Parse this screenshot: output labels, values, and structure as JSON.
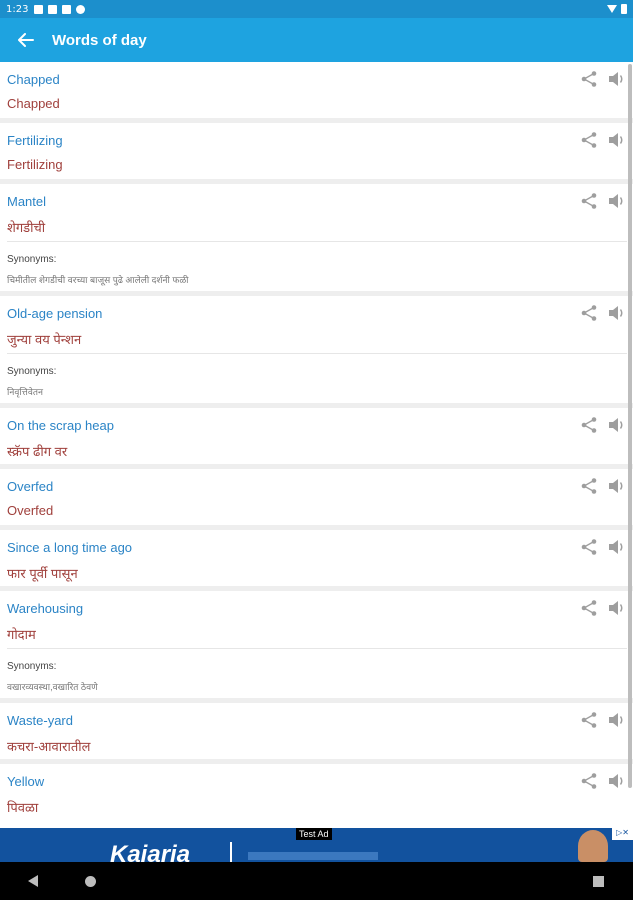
{
  "status_bar": {
    "time": "1:23"
  },
  "app_bar": {
    "title": "Words of day"
  },
  "words": [
    {
      "word": "Chapped",
      "meaning": "Chapped"
    },
    {
      "word": "Fertilizing",
      "meaning": "Fertilizing"
    },
    {
      "word": "Mantel",
      "meaning": "शेगडीची",
      "synonyms_label": "Synonyms:",
      "synonyms": "चिमीतील शेगडीची वरच्या बाजूस पुढे आलेली दर्शनी फळी"
    },
    {
      "word": "Old-age pension",
      "meaning": "जुन्या वय पेन्शन",
      "synonyms_label": "Synonyms:",
      "synonyms": "निवृत्तिवेतन"
    },
    {
      "word": "On the scrap heap",
      "meaning": "स्क्रॅप ढीग वर"
    },
    {
      "word": "Overfed",
      "meaning": "Overfed"
    },
    {
      "word": "Since a long time ago",
      "meaning": "फार पूर्वी पासून"
    },
    {
      "word": "Warehousing",
      "meaning": "गोदाम",
      "synonyms_label": "Synonyms:",
      "synonyms": "वखारव्यवस्था,वखारित ठेवणे"
    },
    {
      "word": "Waste-yard",
      "meaning": "कचरा-आवारातील"
    },
    {
      "word": "Yellow",
      "meaning": "पिवळा"
    }
  ],
  "ad": {
    "label": "Test Ad",
    "brand": "Kajaria"
  },
  "icons": {
    "back": "arrow-left-icon",
    "share": "share-icon",
    "speaker": "speaker-icon"
  },
  "colors": {
    "app_bar": "#1ea3e0",
    "status_bar": "#1c8fcc",
    "word": "#2b84c6",
    "meaning": "#a0403c"
  }
}
